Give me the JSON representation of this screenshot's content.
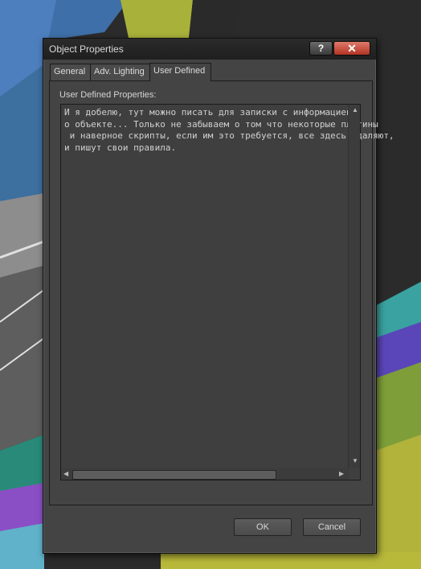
{
  "window": {
    "title": "Object Properties",
    "help_label": "?",
    "close_label": "✕"
  },
  "tabs": [
    {
      "label": "General"
    },
    {
      "label": "Adv. Lighting"
    },
    {
      "label": "User Defined"
    }
  ],
  "user_defined": {
    "label": "User Defined Properties:",
    "text": "И я добелю, тут можно писать для записки с информацией\nо объекте... Только не забываем о том что некоторые плагины\n и наверное скрипты, если им это требуется, все здесь удаляют,\nи пишут свои правила."
  },
  "buttons": {
    "ok": "OK",
    "cancel": "Cancel"
  }
}
